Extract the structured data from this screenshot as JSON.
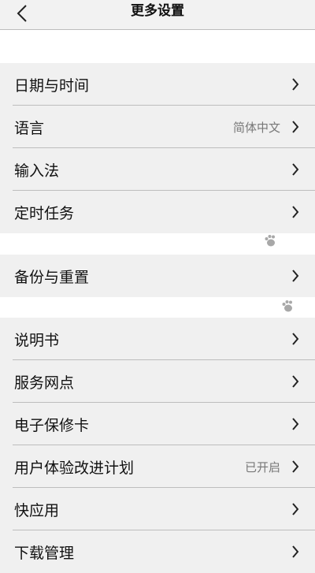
{
  "header": {
    "title": "更多设置",
    "back_icon": "chevron-left-icon"
  },
  "groups": [
    {
      "items": [
        {
          "label": "日期与时间"
        },
        {
          "label": "语言",
          "value": "简体中文"
        },
        {
          "label": "输入法"
        },
        {
          "label": "定时任务"
        }
      ]
    },
    {
      "items": [
        {
          "label": "备份与重置"
        }
      ]
    },
    {
      "items": [
        {
          "label": "说明书"
        },
        {
          "label": "服务网点"
        },
        {
          "label": "电子保修卡"
        },
        {
          "label": "用户体验改进计划",
          "value": "已开启"
        },
        {
          "label": "快应用"
        },
        {
          "label": "下载管理"
        }
      ]
    }
  ],
  "decorations": {
    "paw_icon_color": "#a8a8a8",
    "chevron_color": "#222222"
  }
}
